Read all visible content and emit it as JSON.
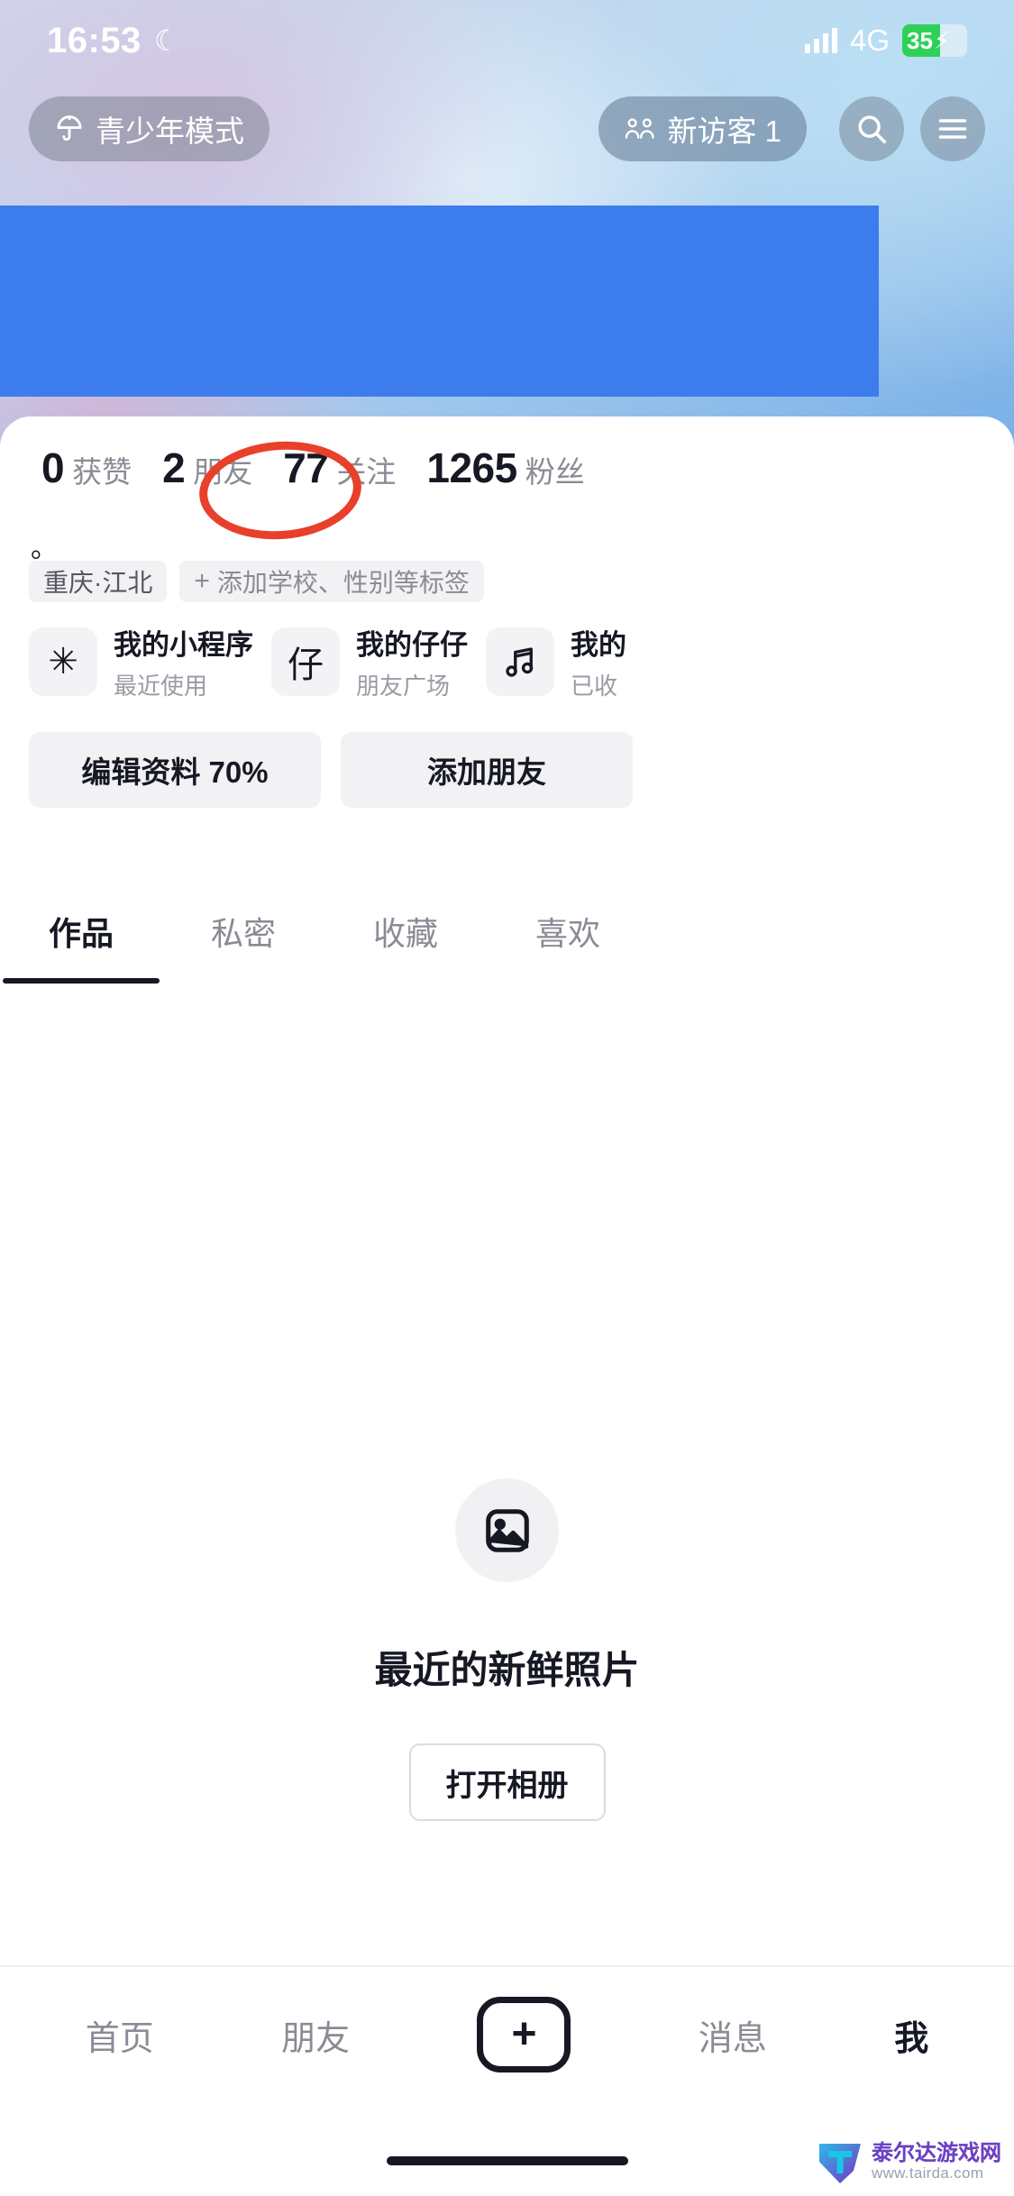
{
  "status_bar": {
    "time": "16:53",
    "moon_icon": "moon-icon",
    "network": "4G",
    "battery_percent": "35",
    "battery_charging_icon": "lightning-bolt-icon",
    "signal_icon": "cellular-signal-icon"
  },
  "header": {
    "teen_mode": {
      "label": "青少年模式",
      "icon": "umbrella-icon"
    },
    "visitors": {
      "label": "新访客 1",
      "icon": "people-icon"
    },
    "search": {
      "icon": "search-icon"
    },
    "menu": {
      "icon": "hamburger-menu-icon"
    }
  },
  "redaction": {
    "color": "#3d7ced"
  },
  "annotation": {
    "color": "#e8402a",
    "target": "关注"
  },
  "profile": {
    "stats": [
      {
        "value": "0",
        "label": "获赞"
      },
      {
        "value": "2",
        "label": "朋友"
      },
      {
        "value": "77",
        "label": "关注"
      },
      {
        "value": "1265",
        "label": "粉丝"
      }
    ],
    "bio": "。",
    "tags": [
      {
        "label": "重庆·江北",
        "type": "location"
      },
      {
        "label": "添加学校、性别等标签",
        "type": "add",
        "plus": "+"
      }
    ],
    "cards": [
      {
        "icon_glyph": "✳",
        "icon_name": "mini-program-icon",
        "title": "我的小程序",
        "subtitle": "最近使用"
      },
      {
        "icon_glyph": "仔",
        "icon_name": "zaizai-icon",
        "title": "我的仔仔",
        "subtitle": "朋友广场"
      },
      {
        "icon_glyph": "♬",
        "icon_name": "music-note-icon",
        "title": "我的",
        "subtitle": "已收"
      }
    ],
    "actions": [
      {
        "label": "编辑资料 70%"
      },
      {
        "label": "添加朋友"
      }
    ]
  },
  "tabs": [
    {
      "label": "作品",
      "active": true
    },
    {
      "label": "私密",
      "active": false
    },
    {
      "label": "收藏",
      "active": false
    },
    {
      "label": "喜欢",
      "active": false
    }
  ],
  "empty_state": {
    "icon": "image-placeholder-icon",
    "title": "最近的新鲜照片",
    "button_label": "打开相册"
  },
  "bottom_nav": [
    {
      "label": "首页",
      "active": false
    },
    {
      "label": "朋友",
      "active": false
    },
    {
      "label": "+",
      "active": false,
      "icon": "create-post-icon"
    },
    {
      "label": "消息",
      "active": false
    },
    {
      "label": "我",
      "active": true
    }
  ],
  "watermark": {
    "name": "泰尔达游戏网",
    "url": "www.tairda.com"
  }
}
